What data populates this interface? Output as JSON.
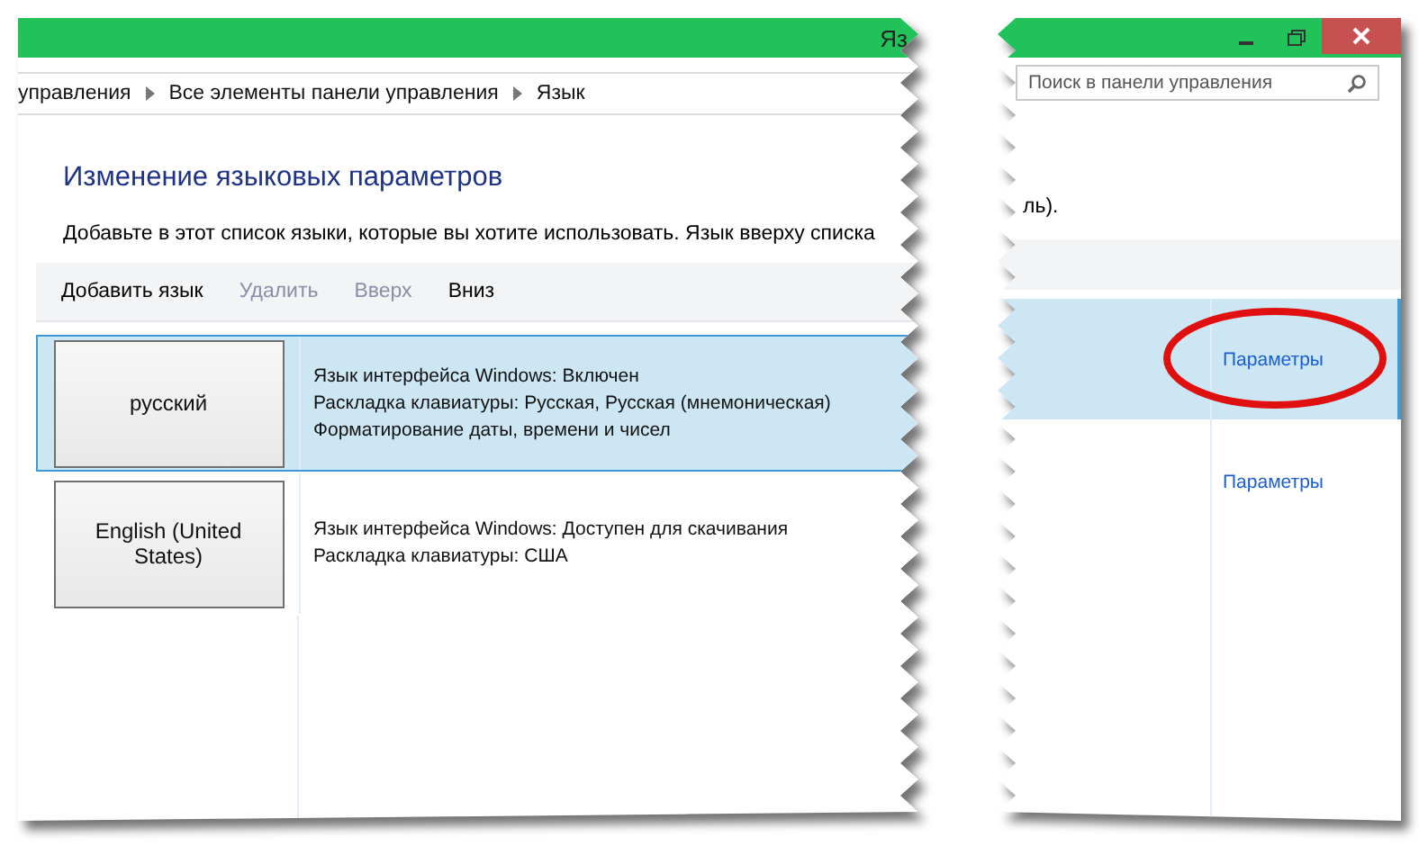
{
  "window": {
    "title": "Яз",
    "search": {
      "placeholder": "Поиск в панели управления"
    }
  },
  "breadcrumb": [
    "управления",
    "Все элементы панели управления",
    "Язык"
  ],
  "heading": "Изменение языковых параметров",
  "description": "Добавьте в этот список языки, которые вы хотите использовать. Язык вверху списка",
  "description_tail": "ль).",
  "toolbar": [
    {
      "label": "Добавить язык",
      "disabled": false
    },
    {
      "label": "Удалить",
      "disabled": true
    },
    {
      "label": "Вверх",
      "disabled": true
    },
    {
      "label": "Вниз",
      "disabled": false
    }
  ],
  "languages": [
    {
      "name": "русский",
      "selected": true,
      "details": [
        "Язык интерфейса Windows: Включен",
        "Раскладка клавиатуры: Русская, Русская (мнемоническая)",
        "Форматирование даты, времени и чисел"
      ],
      "options_link": "Параметры",
      "circled": true
    },
    {
      "name": "English (United States)",
      "selected": false,
      "details": [
        "Язык интерфейса Windows: Доступен для скачивания",
        "Раскладка клавиатуры: США"
      ],
      "options_link": "Параметры",
      "circled": false
    }
  ]
}
